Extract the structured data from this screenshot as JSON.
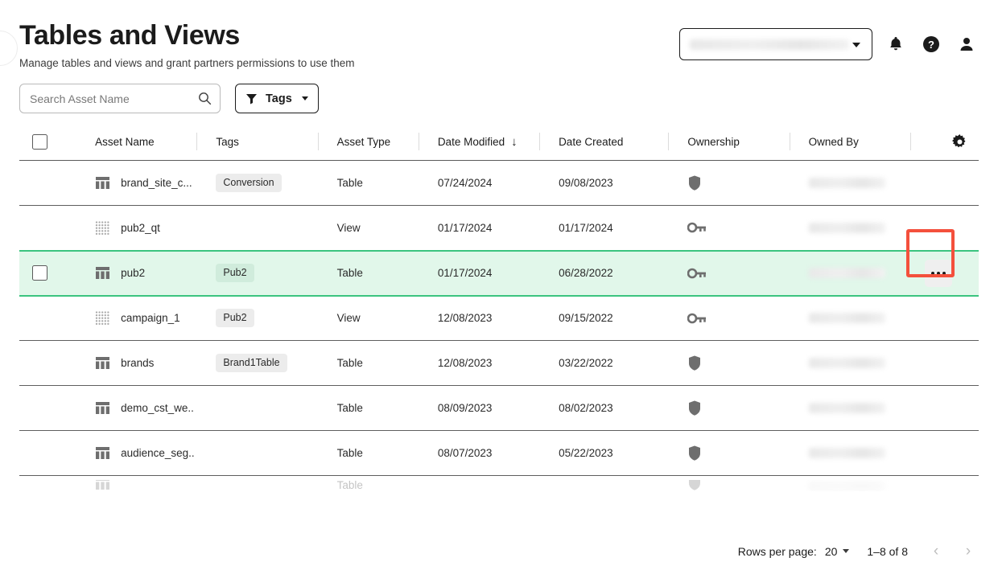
{
  "header": {
    "title": "Tables and Views",
    "subtitle": "Manage tables and views and grant partners permissions to use them",
    "account_selector": {
      "value": "",
      "redacted": true,
      "icon": "chevron-down-icon"
    },
    "notifications_icon": "bell-icon",
    "help_icon": "help-circle-icon",
    "profile_icon": "user-icon"
  },
  "toolbar": {
    "search_placeholder": "Search Asset Name",
    "search_value": "",
    "search_icon": "search-icon",
    "tags_label": "Tags",
    "tags_filter_icon": "funnel-icon",
    "tags_caret_icon": "chevron-down-icon"
  },
  "table": {
    "settings_icon": "gear-icon",
    "select_all_checkbox": false,
    "columns": [
      {
        "key": "check",
        "label": ""
      },
      {
        "key": "name",
        "label": "Asset Name"
      },
      {
        "key": "tags",
        "label": "Tags"
      },
      {
        "key": "type",
        "label": "Asset Type"
      },
      {
        "key": "modified",
        "label": "Date Modified",
        "sorted": "desc",
        "sort_icon": "arrow-down-icon"
      },
      {
        "key": "created",
        "label": "Date Created"
      },
      {
        "key": "ownership",
        "label": "Ownership"
      },
      {
        "key": "ownedby",
        "label": "Owned By"
      },
      {
        "key": "gear",
        "label": ""
      }
    ],
    "rows": [
      {
        "asset_name": "brand_site_c...",
        "asset_icon": "table-icon",
        "tag": "Conversion",
        "asset_type": "Table",
        "date_modified": "07/24/2024",
        "date_created": "09/08/2023",
        "ownership_icon": "shield-icon",
        "owned_by": "",
        "owned_by_redacted": true,
        "selected": false,
        "show_checkbox": false,
        "show_more": false
      },
      {
        "asset_name": "pub2_qt",
        "asset_icon": "view-icon",
        "tag": "",
        "asset_type": "View",
        "date_modified": "01/17/2024",
        "date_created": "01/17/2024",
        "ownership_icon": "key-icon",
        "owned_by": "",
        "owned_by_redacted": true,
        "selected": false,
        "show_checkbox": false,
        "show_more": false
      },
      {
        "asset_name": "pub2",
        "asset_icon": "table-icon",
        "tag": "Pub2",
        "asset_type": "Table",
        "date_modified": "01/17/2024",
        "date_created": "06/28/2022",
        "ownership_icon": "key-icon",
        "owned_by": "",
        "owned_by_redacted": true,
        "selected": true,
        "show_checkbox": true,
        "show_more": true
      },
      {
        "asset_name": "campaign_1",
        "asset_icon": "view-icon",
        "tag": "Pub2",
        "asset_type": "View",
        "date_modified": "12/08/2023",
        "date_created": "09/15/2022",
        "ownership_icon": "key-icon",
        "owned_by": "",
        "owned_by_redacted": true,
        "selected": false,
        "show_checkbox": false,
        "show_more": false
      },
      {
        "asset_name": "brands",
        "asset_icon": "table-icon",
        "tag": "Brand1Table",
        "asset_type": "Table",
        "date_modified": "12/08/2023",
        "date_created": "03/22/2022",
        "ownership_icon": "shield-icon",
        "owned_by": "",
        "owned_by_redacted": true,
        "selected": false,
        "show_checkbox": false,
        "show_more": false
      },
      {
        "asset_name": "demo_cst_we..",
        "asset_icon": "table-icon",
        "tag": "",
        "asset_type": "Table",
        "date_modified": "08/09/2023",
        "date_created": "08/02/2023",
        "ownership_icon": "shield-icon",
        "owned_by": "",
        "owned_by_redacted": true,
        "selected": false,
        "show_checkbox": false,
        "show_more": false
      },
      {
        "asset_name": "audience_seg..",
        "asset_icon": "table-icon",
        "tag": "",
        "asset_type": "Table",
        "date_modified": "08/07/2023",
        "date_created": "05/22/2023",
        "ownership_icon": "shield-icon",
        "owned_by": "",
        "owned_by_redacted": true,
        "selected": false,
        "show_checkbox": false,
        "show_more": false
      }
    ],
    "partial_row": {
      "asset_name": "",
      "asset_icon": "table-icon",
      "asset_type": "Table",
      "date_modified": "",
      "date_created": "",
      "ownership_icon": "shield-icon",
      "owned_by": "",
      "clipped": true
    }
  },
  "annotation": {
    "type": "highlight-box",
    "color": "#f4503c",
    "target": "row-more-menu-button"
  },
  "footer": {
    "rows_per_page_label": "Rows per page:",
    "rows_per_page_value": "20",
    "rows_per_page_caret": "chevron-down-icon",
    "range_label": "1–8 of 8",
    "prev_icon": "chevron-left-icon",
    "next_icon": "chevron-right-icon",
    "prev_enabled": false,
    "next_enabled": false
  }
}
